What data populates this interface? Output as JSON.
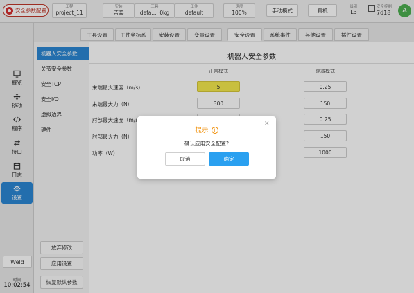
{
  "topbar": {
    "safety_config_label": "安全参数配置",
    "project": {
      "label": "工程",
      "value": "project_11"
    },
    "install": {
      "label": "安装",
      "value": "吉装"
    },
    "tool": {
      "label": "工具",
      "name": "defa...",
      "load": "0kg"
    },
    "workpiece": {
      "label": "工件",
      "value": "default"
    },
    "speed": {
      "label": "速度",
      "value": "100%"
    },
    "mode_button": "手动模式",
    "real_button": "真机",
    "level": {
      "label": "级别",
      "value": "L3"
    },
    "safety_control": {
      "label": "安全控制",
      "value": "7d18"
    },
    "avatar": "A"
  },
  "nav": {
    "items": [
      {
        "label": "概览",
        "icon": "monitor-icon"
      },
      {
        "label": "移动",
        "icon": "move-arrows-icon"
      },
      {
        "label": "程序",
        "icon": "code-icon"
      },
      {
        "label": "接口",
        "icon": "swap-icon"
      },
      {
        "label": "日志",
        "icon": "calendar-icon"
      },
      {
        "label": "设置",
        "icon": "gear-icon"
      }
    ],
    "active": "设置",
    "weld_button": "Weld",
    "time_label": "时间",
    "time_value": "10:02:54"
  },
  "tabs": [
    "工具设置",
    "工件坐标系",
    "安装设置",
    "变量设置",
    "安全设置",
    "系统事件",
    "其他设置",
    "插件设置"
  ],
  "active_tab": "安全设置",
  "sections": [
    "机器人安全参数",
    "关节安全参数",
    "安全TCP",
    "安全I/O",
    "虚拟边界",
    "硬件"
  ],
  "section_buttons": [
    "放弃修改",
    "应用设置",
    "恢复默认参数"
  ],
  "main": {
    "title": "机器人安全参数",
    "col_normal": "正常模式",
    "col_reduced": "缩减模式",
    "rows": [
      {
        "label": "末端最大速度（m/s）",
        "normal": "5",
        "reduced": "0.25"
      },
      {
        "label": "末端最大力（N）",
        "normal": "300",
        "reduced": "150"
      },
      {
        "label": "肘部最大速度（m/s）",
        "normal": "",
        "reduced": "0.25"
      },
      {
        "label": "肘部最大力（N）",
        "normal": "",
        "reduced": "150"
      },
      {
        "label": "功率（W）",
        "normal": "",
        "reduced": "1000"
      }
    ]
  },
  "dialog": {
    "title": "提示",
    "message": "确认应用安全配置?",
    "cancel": "取消",
    "confirm": "确定"
  },
  "colors": {
    "accent": "#2b87d3",
    "confirm": "#2aa0f0",
    "highlight": "#f5e94e",
    "warning": "#f08c00",
    "alert": "#d63031"
  }
}
